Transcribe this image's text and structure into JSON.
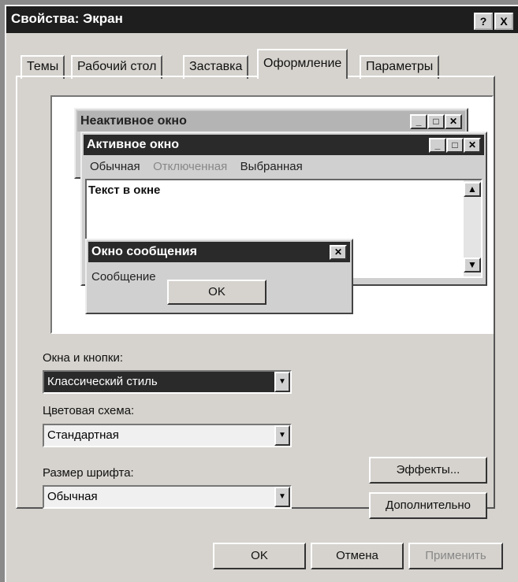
{
  "dialog": {
    "title": "Свойства: Экран",
    "help_glyph": "?",
    "close_glyph": "X"
  },
  "tabs": [
    "Темы",
    "Рабочий стол",
    "Заставка",
    "Оформление",
    "Параметры"
  ],
  "active_tab": "Оформление",
  "preview": {
    "inactive_title": "Неактивное окно",
    "active_title": "Активное окно",
    "menu_items": [
      "Обычная",
      "Отключенная",
      "Выбранная"
    ],
    "window_text": "Текст в окне",
    "message_title": "Окно сообщения",
    "message_text": "Сообщение",
    "message_ok": "OK"
  },
  "fields": {
    "windows_buttons_label": "Окна и кнопки:",
    "windows_buttons_value": "Классический стиль",
    "color_scheme_label": "Цветовая схема:",
    "color_scheme_value": "Стандартная",
    "font_size_label": "Размер шрифта:",
    "font_size_value": "Обычная"
  },
  "buttons": {
    "effects": "Эффекты...",
    "advanced": "Дополнительно",
    "ok": "OK",
    "cancel": "Отмена",
    "apply": "Применить"
  }
}
